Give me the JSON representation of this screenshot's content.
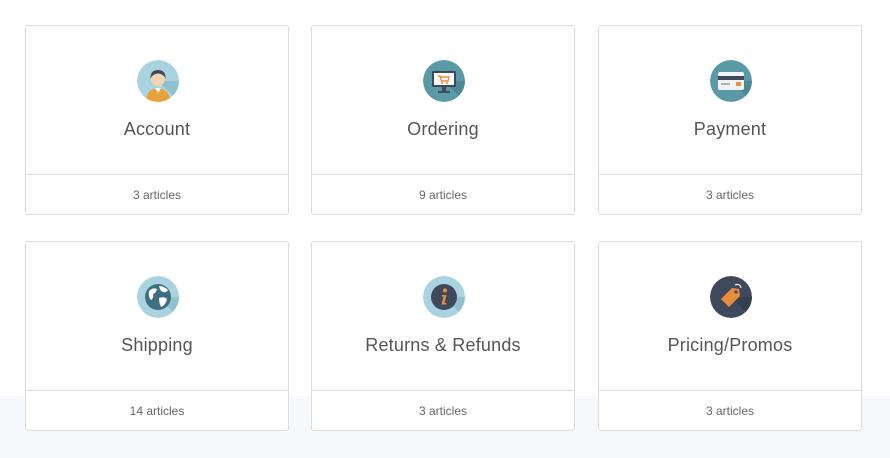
{
  "categories": [
    {
      "title": "Account",
      "count": "3 articles",
      "icon": "person-icon"
    },
    {
      "title": "Ordering",
      "count": "9 articles",
      "icon": "computer-cart-icon"
    },
    {
      "title": "Payment",
      "count": "3 articles",
      "icon": "credit-card-icon"
    },
    {
      "title": "Shipping",
      "count": "14 articles",
      "icon": "globe-icon"
    },
    {
      "title": "Returns & Refunds",
      "count": "3 articles",
      "icon": "info-icon"
    },
    {
      "title": "Pricing/Promos",
      "count": "3 articles",
      "icon": "price-tag-icon"
    }
  ],
  "colors": {
    "border": "#dcdcdc",
    "title_text": "#555555",
    "count_text": "#666666",
    "icon_teal": "#5a9aa6",
    "icon_light": "#a9d3de",
    "icon_dark": "#3e4a5c",
    "accent_orange": "#e98d3a"
  }
}
